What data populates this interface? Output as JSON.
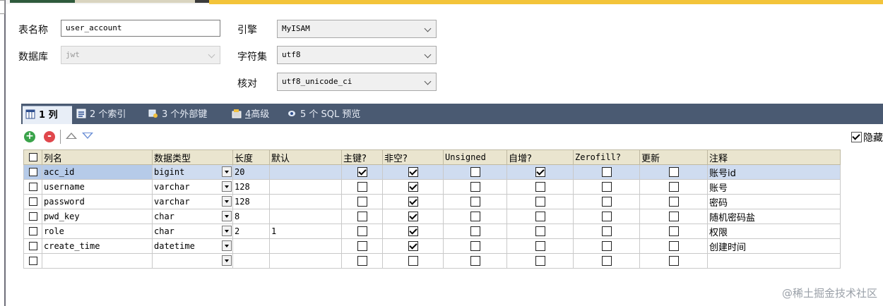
{
  "form": {
    "table_name_label": "表名称",
    "table_name_value": "user_account",
    "database_label": "数据库",
    "database_value": "jwt",
    "engine_label": "引擎",
    "engine_value": "MyISAM",
    "charset_label": "字符集",
    "charset_value": "utf8",
    "collation_label": "核对",
    "collation_value": "utf8_unicode_ci"
  },
  "tabs": {
    "columns_count": "1",
    "columns_label": "列",
    "indexes": "2 个索引",
    "foreign_keys": "3 个外部键",
    "advanced_num": "4",
    "advanced_label": "高级",
    "sql_preview": "5 个 SQL 预览"
  },
  "toolbar": {
    "add_icon": "+",
    "remove_icon": "-",
    "hide_label": "隐藏"
  },
  "grid": {
    "headers": [
      "列名",
      "数据类型",
      "长度",
      "默认",
      "主键?",
      "非空?",
      "Unsigned",
      "自增?",
      "Zerofill?",
      "更新",
      "注释"
    ],
    "rows": [
      {
        "name": "acc_id",
        "type": "bigint",
        "length": "20",
        "default": "",
        "pk": true,
        "notnull": true,
        "unsigned": false,
        "autoinc": true,
        "zerofill": false,
        "update": false,
        "comment": "账号id"
      },
      {
        "name": "username",
        "type": "varchar",
        "length": "128",
        "default": "",
        "pk": false,
        "notnull": true,
        "unsigned": false,
        "autoinc": false,
        "zerofill": false,
        "update": false,
        "comment": "账号"
      },
      {
        "name": "password",
        "type": "varchar",
        "length": "128",
        "default": "",
        "pk": false,
        "notnull": true,
        "unsigned": false,
        "autoinc": false,
        "zerofill": false,
        "update": false,
        "comment": "密码"
      },
      {
        "name": "pwd_key",
        "type": "char",
        "length": "8",
        "default": "",
        "pk": false,
        "notnull": true,
        "unsigned": false,
        "autoinc": false,
        "zerofill": false,
        "update": false,
        "comment": "随机密码盐"
      },
      {
        "name": "role",
        "type": "char",
        "length": "2",
        "default": "1",
        "pk": false,
        "notnull": true,
        "unsigned": false,
        "autoinc": false,
        "zerofill": false,
        "update": false,
        "comment": "权限"
      },
      {
        "name": "create_time",
        "type": "datetime",
        "length": "",
        "default": "",
        "pk": false,
        "notnull": true,
        "unsigned": false,
        "autoinc": false,
        "zerofill": false,
        "update": false,
        "comment": "创建时间"
      },
      {
        "name": "",
        "type": "",
        "length": "",
        "default": "",
        "pk": false,
        "notnull": false,
        "unsigned": false,
        "autoinc": false,
        "zerofill": false,
        "update": false,
        "comment": ""
      }
    ]
  },
  "watermark": "@稀土掘金技术社区",
  "colors": {
    "tabbar": "#4a5a72",
    "header": "#eae5cf",
    "selected_row": "#cfdcf0",
    "top_accent": "#f3c43a"
  }
}
